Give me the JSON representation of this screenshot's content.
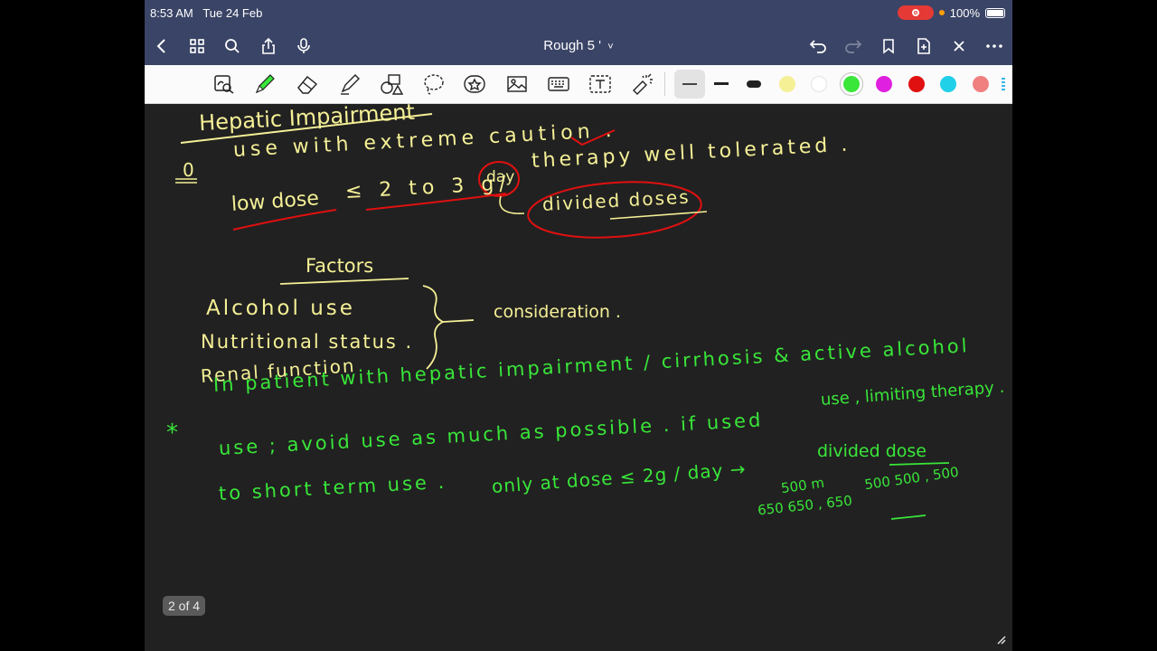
{
  "status_bar": {
    "time": "8:53 AM",
    "date": "Tue 24 Feb",
    "battery": "100%"
  },
  "navbar": {
    "title": "Rough 5 '"
  },
  "toolbar": {
    "tools": [
      "read-mode-icon",
      "pen-icon",
      "eraser-icon",
      "highlighter-icon",
      "shapes-icon",
      "lasso-icon",
      "sticker-icon",
      "image-icon",
      "keyboard-icon",
      "text-icon",
      "laser-pointer-icon"
    ],
    "colors": [
      "#f5f096",
      "#ffffff",
      "#39e639",
      "#e020e0",
      "#e01010",
      "#20d0e8",
      "#f08080"
    ],
    "selected_color": "#39e639"
  },
  "notes": {
    "heading": "Hepatic Impairment",
    "bullet": "0",
    "line1": "use with extreme caution .",
    "line2a": "therapy well tolerated .",
    "line3a": "low dose",
    "line3b": "≤ 2 to 3 g/",
    "line3c": "day",
    "line3d": "divided doses",
    "factors_title": "Factors",
    "factor1": "Alcohol use",
    "factor2": "Nutritional status .",
    "factor3": "Renal function",
    "consideration": "consideration .",
    "star": "*",
    "g1": "In patient with hepatic impairment / cirrhosis & active alcohol",
    "g1b": "use , limiting therapy .",
    "g2": "use ; avoid use as much as possible . if used",
    "g2b": "only at dose ≤ 2g / day →",
    "g2c": "divided dose",
    "g3": "to short term use .",
    "n1": "500 m",
    "n2": "500 500 , 500",
    "n3": "650 650 , 650"
  },
  "page_indicator": "2 of 4"
}
